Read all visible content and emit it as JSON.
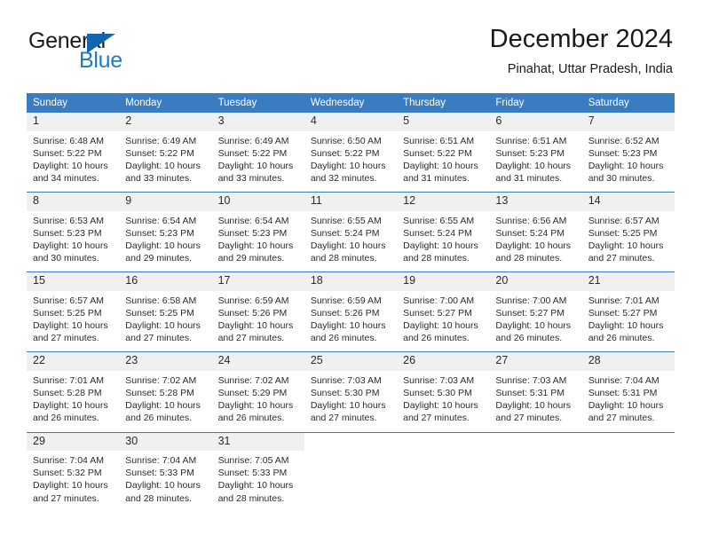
{
  "brand": {
    "name_top": "General",
    "name_bottom": "Blue",
    "triangle_color": "#1266ad",
    "blue_text_color": "#1f7ac4"
  },
  "header": {
    "title": "December 2024",
    "subtitle": "Pinahat, Uttar Pradesh, India"
  },
  "theme": {
    "header_row_bg": "#3a7cc0",
    "day_number_bg": "#f0f0f0",
    "divider_color": "#3a7cc0",
    "text_color": "#2b2b2b"
  },
  "weekdays": [
    "Sunday",
    "Monday",
    "Tuesday",
    "Wednesday",
    "Thursday",
    "Friday",
    "Saturday"
  ],
  "weeks": [
    [
      {
        "day": "1",
        "sunrise": "Sunrise: 6:48 AM",
        "sunset": "Sunset: 5:22 PM",
        "daylight_line1": "Daylight: 10 hours",
        "daylight_line2": "and 34 minutes."
      },
      {
        "day": "2",
        "sunrise": "Sunrise: 6:49 AM",
        "sunset": "Sunset: 5:22 PM",
        "daylight_line1": "Daylight: 10 hours",
        "daylight_line2": "and 33 minutes."
      },
      {
        "day": "3",
        "sunrise": "Sunrise: 6:49 AM",
        "sunset": "Sunset: 5:22 PM",
        "daylight_line1": "Daylight: 10 hours",
        "daylight_line2": "and 33 minutes."
      },
      {
        "day": "4",
        "sunrise": "Sunrise: 6:50 AM",
        "sunset": "Sunset: 5:22 PM",
        "daylight_line1": "Daylight: 10 hours",
        "daylight_line2": "and 32 minutes."
      },
      {
        "day": "5",
        "sunrise": "Sunrise: 6:51 AM",
        "sunset": "Sunset: 5:22 PM",
        "daylight_line1": "Daylight: 10 hours",
        "daylight_line2": "and 31 minutes."
      },
      {
        "day": "6",
        "sunrise": "Sunrise: 6:51 AM",
        "sunset": "Sunset: 5:23 PM",
        "daylight_line1": "Daylight: 10 hours",
        "daylight_line2": "and 31 minutes."
      },
      {
        "day": "7",
        "sunrise": "Sunrise: 6:52 AM",
        "sunset": "Sunset: 5:23 PM",
        "daylight_line1": "Daylight: 10 hours",
        "daylight_line2": "and 30 minutes."
      }
    ],
    [
      {
        "day": "8",
        "sunrise": "Sunrise: 6:53 AM",
        "sunset": "Sunset: 5:23 PM",
        "daylight_line1": "Daylight: 10 hours",
        "daylight_line2": "and 30 minutes."
      },
      {
        "day": "9",
        "sunrise": "Sunrise: 6:54 AM",
        "sunset": "Sunset: 5:23 PM",
        "daylight_line1": "Daylight: 10 hours",
        "daylight_line2": "and 29 minutes."
      },
      {
        "day": "10",
        "sunrise": "Sunrise: 6:54 AM",
        "sunset": "Sunset: 5:23 PM",
        "daylight_line1": "Daylight: 10 hours",
        "daylight_line2": "and 29 minutes."
      },
      {
        "day": "11",
        "sunrise": "Sunrise: 6:55 AM",
        "sunset": "Sunset: 5:24 PM",
        "daylight_line1": "Daylight: 10 hours",
        "daylight_line2": "and 28 minutes."
      },
      {
        "day": "12",
        "sunrise": "Sunrise: 6:55 AM",
        "sunset": "Sunset: 5:24 PM",
        "daylight_line1": "Daylight: 10 hours",
        "daylight_line2": "and 28 minutes."
      },
      {
        "day": "13",
        "sunrise": "Sunrise: 6:56 AM",
        "sunset": "Sunset: 5:24 PM",
        "daylight_line1": "Daylight: 10 hours",
        "daylight_line2": "and 28 minutes."
      },
      {
        "day": "14",
        "sunrise": "Sunrise: 6:57 AM",
        "sunset": "Sunset: 5:25 PM",
        "daylight_line1": "Daylight: 10 hours",
        "daylight_line2": "and 27 minutes."
      }
    ],
    [
      {
        "day": "15",
        "sunrise": "Sunrise: 6:57 AM",
        "sunset": "Sunset: 5:25 PM",
        "daylight_line1": "Daylight: 10 hours",
        "daylight_line2": "and 27 minutes."
      },
      {
        "day": "16",
        "sunrise": "Sunrise: 6:58 AM",
        "sunset": "Sunset: 5:25 PM",
        "daylight_line1": "Daylight: 10 hours",
        "daylight_line2": "and 27 minutes."
      },
      {
        "day": "17",
        "sunrise": "Sunrise: 6:59 AM",
        "sunset": "Sunset: 5:26 PM",
        "daylight_line1": "Daylight: 10 hours",
        "daylight_line2": "and 27 minutes."
      },
      {
        "day": "18",
        "sunrise": "Sunrise: 6:59 AM",
        "sunset": "Sunset: 5:26 PM",
        "daylight_line1": "Daylight: 10 hours",
        "daylight_line2": "and 26 minutes."
      },
      {
        "day": "19",
        "sunrise": "Sunrise: 7:00 AM",
        "sunset": "Sunset: 5:27 PM",
        "daylight_line1": "Daylight: 10 hours",
        "daylight_line2": "and 26 minutes."
      },
      {
        "day": "20",
        "sunrise": "Sunrise: 7:00 AM",
        "sunset": "Sunset: 5:27 PM",
        "daylight_line1": "Daylight: 10 hours",
        "daylight_line2": "and 26 minutes."
      },
      {
        "day": "21",
        "sunrise": "Sunrise: 7:01 AM",
        "sunset": "Sunset: 5:27 PM",
        "daylight_line1": "Daylight: 10 hours",
        "daylight_line2": "and 26 minutes."
      }
    ],
    [
      {
        "day": "22",
        "sunrise": "Sunrise: 7:01 AM",
        "sunset": "Sunset: 5:28 PM",
        "daylight_line1": "Daylight: 10 hours",
        "daylight_line2": "and 26 minutes."
      },
      {
        "day": "23",
        "sunrise": "Sunrise: 7:02 AM",
        "sunset": "Sunset: 5:28 PM",
        "daylight_line1": "Daylight: 10 hours",
        "daylight_line2": "and 26 minutes."
      },
      {
        "day": "24",
        "sunrise": "Sunrise: 7:02 AM",
        "sunset": "Sunset: 5:29 PM",
        "daylight_line1": "Daylight: 10 hours",
        "daylight_line2": "and 26 minutes."
      },
      {
        "day": "25",
        "sunrise": "Sunrise: 7:03 AM",
        "sunset": "Sunset: 5:30 PM",
        "daylight_line1": "Daylight: 10 hours",
        "daylight_line2": "and 27 minutes."
      },
      {
        "day": "26",
        "sunrise": "Sunrise: 7:03 AM",
        "sunset": "Sunset: 5:30 PM",
        "daylight_line1": "Daylight: 10 hours",
        "daylight_line2": "and 27 minutes."
      },
      {
        "day": "27",
        "sunrise": "Sunrise: 7:03 AM",
        "sunset": "Sunset: 5:31 PM",
        "daylight_line1": "Daylight: 10 hours",
        "daylight_line2": "and 27 minutes."
      },
      {
        "day": "28",
        "sunrise": "Sunrise: 7:04 AM",
        "sunset": "Sunset: 5:31 PM",
        "daylight_line1": "Daylight: 10 hours",
        "daylight_line2": "and 27 minutes."
      }
    ],
    [
      {
        "day": "29",
        "sunrise": "Sunrise: 7:04 AM",
        "sunset": "Sunset: 5:32 PM",
        "daylight_line1": "Daylight: 10 hours",
        "daylight_line2": "and 27 minutes."
      },
      {
        "day": "30",
        "sunrise": "Sunrise: 7:04 AM",
        "sunset": "Sunset: 5:33 PM",
        "daylight_line1": "Daylight: 10 hours",
        "daylight_line2": "and 28 minutes."
      },
      {
        "day": "31",
        "sunrise": "Sunrise: 7:05 AM",
        "sunset": "Sunset: 5:33 PM",
        "daylight_line1": "Daylight: 10 hours",
        "daylight_line2": "and 28 minutes."
      },
      {
        "day": "",
        "sunrise": "",
        "sunset": "",
        "daylight_line1": "",
        "daylight_line2": ""
      },
      {
        "day": "",
        "sunrise": "",
        "sunset": "",
        "daylight_line1": "",
        "daylight_line2": ""
      },
      {
        "day": "",
        "sunrise": "",
        "sunset": "",
        "daylight_line1": "",
        "daylight_line2": ""
      },
      {
        "day": "",
        "sunrise": "",
        "sunset": "",
        "daylight_line1": "",
        "daylight_line2": ""
      }
    ]
  ]
}
